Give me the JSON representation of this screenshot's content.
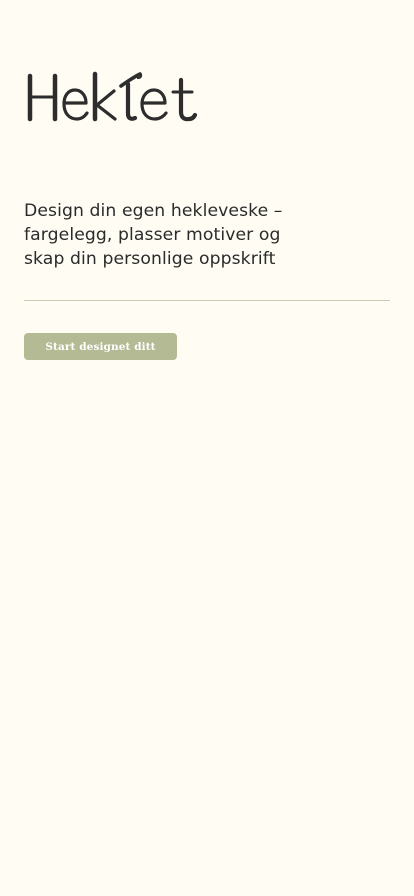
{
  "app": {
    "logo_text": "Heklet",
    "tagline": "Design din egen hekleveske – fargelegg, plasser motiver og skap din personlige oppskrift",
    "cta_label": "Start designet ditt"
  },
  "colors": {
    "background": "#fefcf3",
    "text": "#2b2b2b",
    "accent": "#b4ba94",
    "divider": "#c9ccae"
  }
}
